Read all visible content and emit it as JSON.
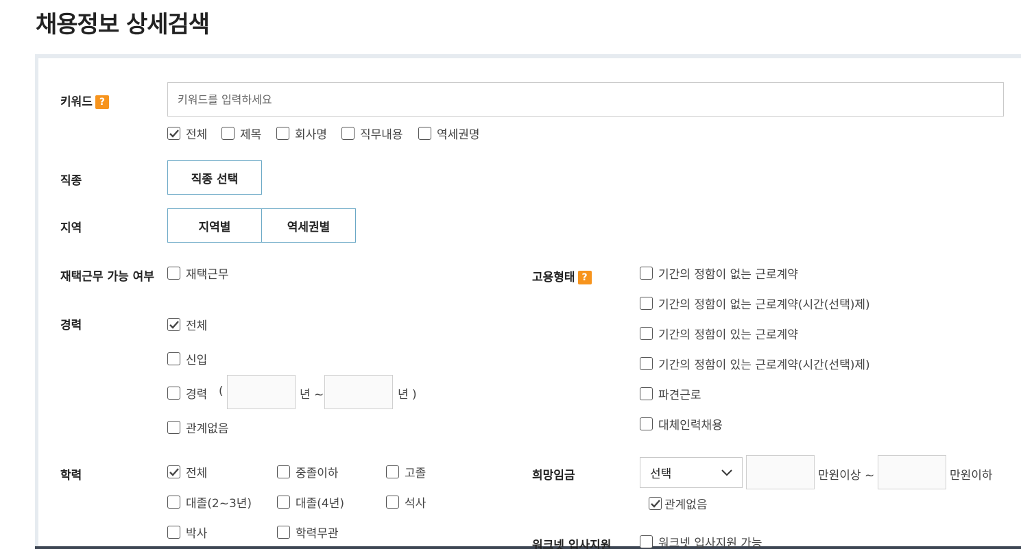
{
  "page": {
    "title": "채용정보 상세검색"
  },
  "keyword": {
    "label": "키워드",
    "help": "?",
    "placeholder": "키워드를 입력하세요",
    "options": [
      {
        "label": "전체",
        "checked": true
      },
      {
        "label": "제목",
        "checked": false
      },
      {
        "label": "회사명",
        "checked": false
      },
      {
        "label": "직무내용",
        "checked": false
      },
      {
        "label": "역세권명",
        "checked": false
      }
    ]
  },
  "job_type": {
    "label": "직종",
    "button": "직종 선택"
  },
  "region": {
    "label": "지역",
    "button_region": "지역별",
    "button_station": "역세권별"
  },
  "remote": {
    "label": "재택근무 가능 여부",
    "option": "재택근무"
  },
  "career": {
    "label": "경력",
    "options": [
      "전체",
      "신입",
      "경력",
      "관계없음"
    ],
    "open_paren": "(",
    "year_sep": "년 ~",
    "year_end": "년 )"
  },
  "education": {
    "label": "학력",
    "options": [
      "전체",
      "중졸이하",
      "고졸",
      "대졸(2~3년)",
      "대졸(4년)",
      "석사",
      "박사",
      "학력무관"
    ]
  },
  "employment": {
    "label": "고용형태",
    "help": "?",
    "options": [
      "기간의 정함이 없는 근로계약",
      "기간의 정함이 없는 근로계약(시간(선택)제)",
      "기간의 정함이 있는 근로계약",
      "기간의 정함이 있는 근로계약(시간(선택)제)",
      "파견근로",
      "대체인력채용"
    ]
  },
  "salary": {
    "label": "희망임금",
    "select_value": "선택",
    "min_suffix": "만원이상 ~",
    "max_suffix": "만원이하",
    "any": "관계없음"
  },
  "worknet": {
    "label": "워크넷 입사지원",
    "option": "워크넷 입사지원 가능"
  },
  "colors": {
    "accent_help": "#f7941d",
    "button_border": "#6aa8c6",
    "panel_border": "#e6ebf0"
  }
}
